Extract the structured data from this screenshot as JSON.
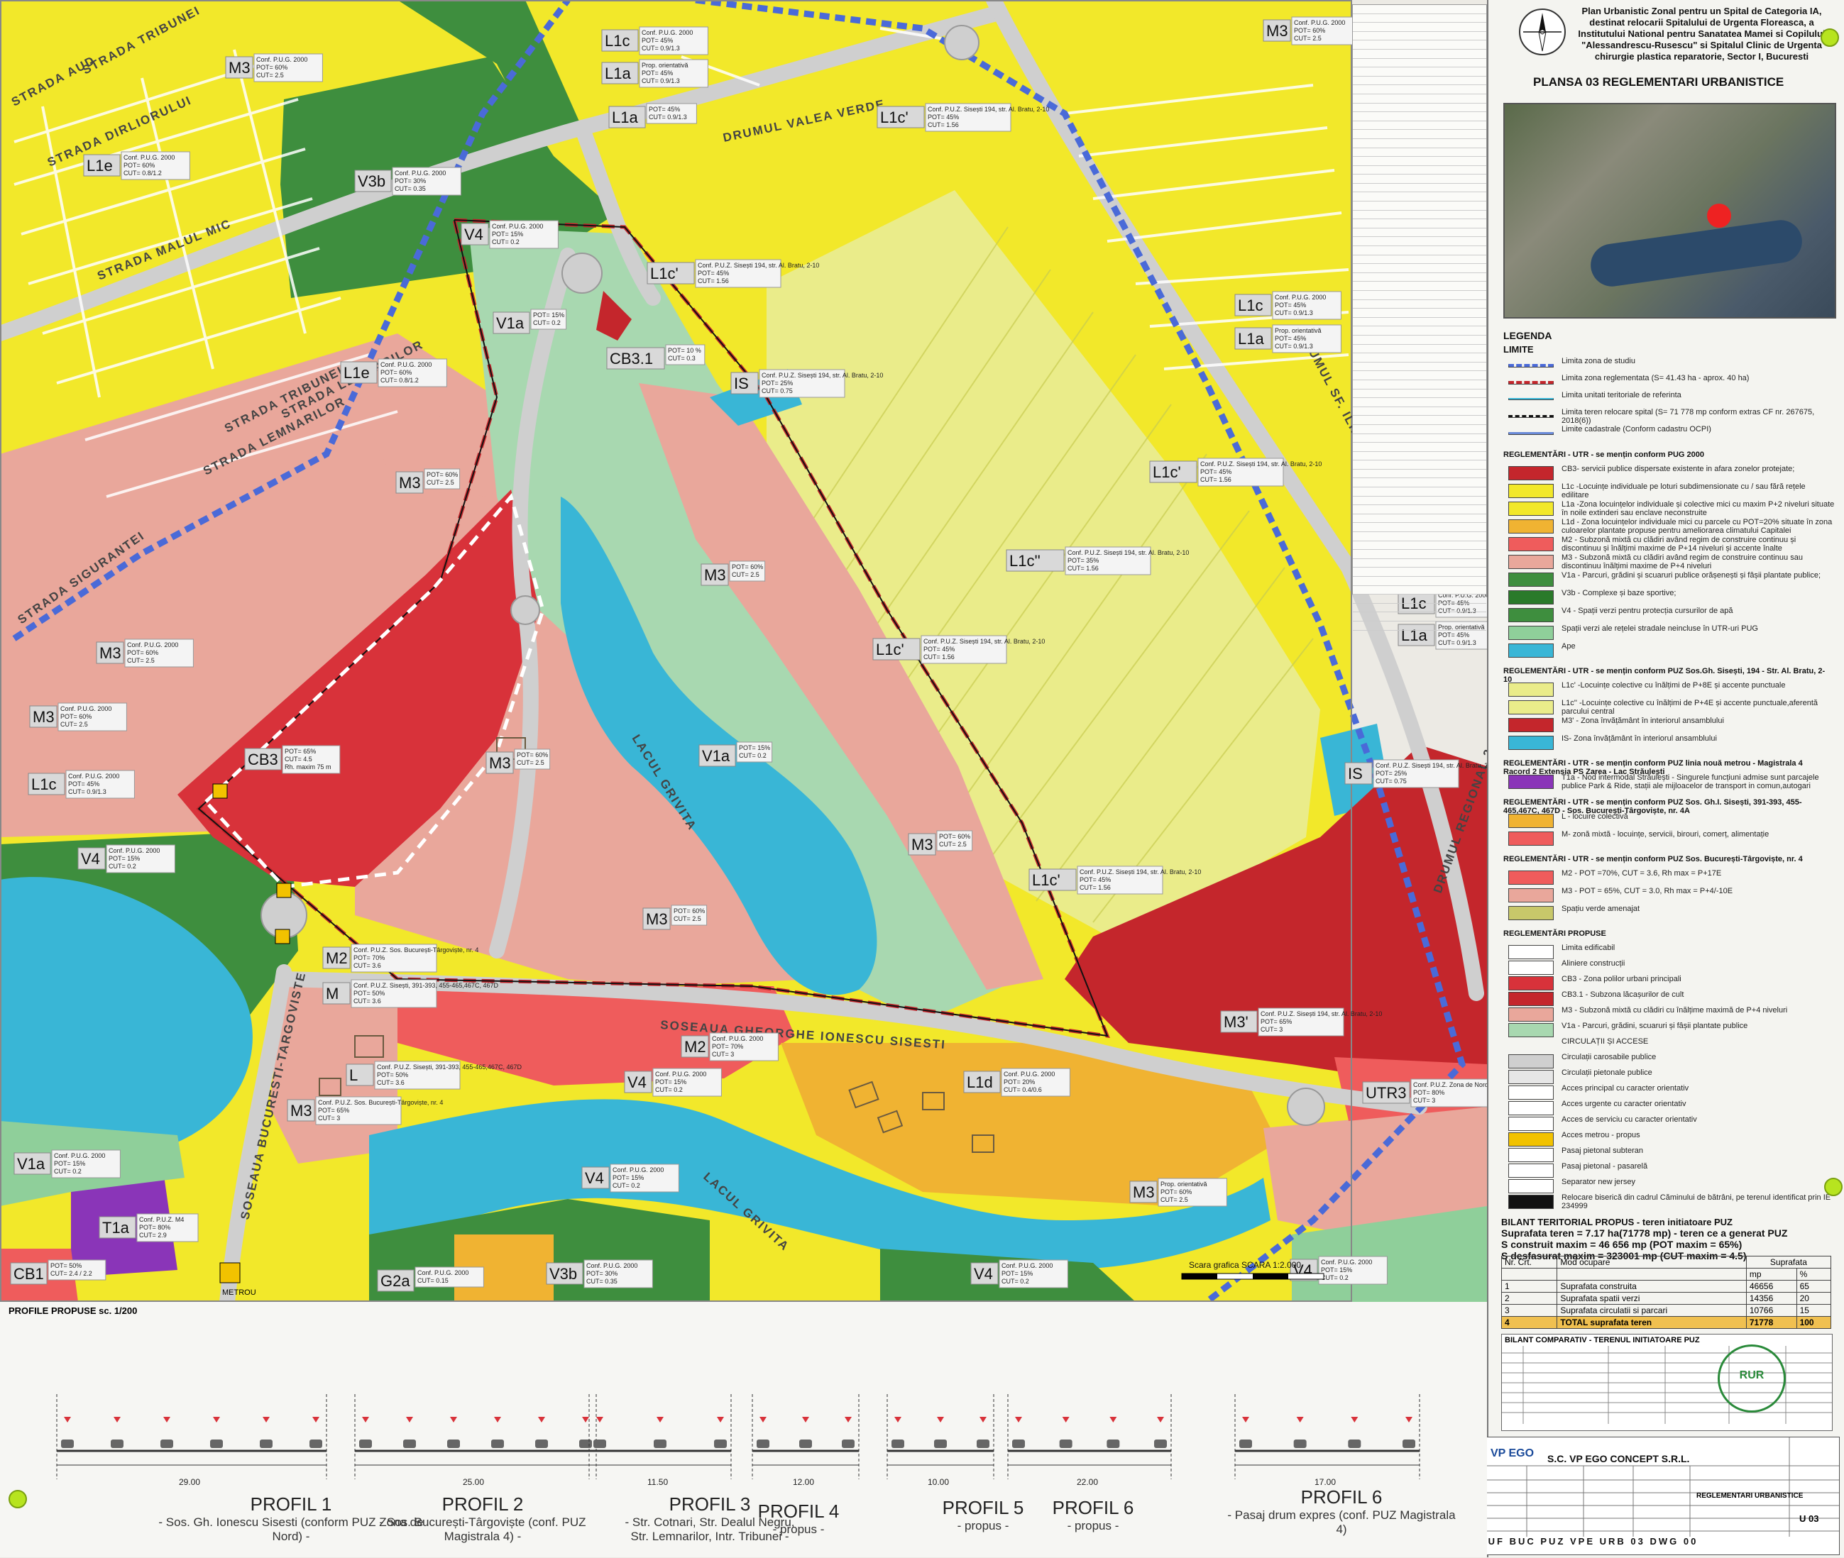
{
  "header": {
    "title": "Plan Urbanistic Zonal pentru un Spital de Categoria IA, destinat relocarii Spitalului de Urgenta Floreasca, a Institutului National pentru Sanatatea Mamei si Copilului \"Alessandrescu-Rusescu\" si Spitalul Clinic de Urgenta chirurgie plastica reparatorie, Sector I, Bucuresti",
    "plansa": "PLANSA 03 REGLEMENTARI URBANISTICE"
  },
  "colors": {
    "yellow": "#f2e82a",
    "light_yellow": "#eaec8a",
    "pink": "#e9a79b",
    "red": "#d8323a",
    "dark_red": "#c4262c",
    "salmon": "#ef5c5c",
    "green": "#3e8e3e",
    "light_green": "#8fcf9a",
    "cyan": "#39b6d6",
    "orange": "#f0b332",
    "purple": "#8a35b8",
    "mint": "#a8d8b0",
    "road": "#cfcfcf"
  },
  "streets": [
    "STRADA AUD",
    "STRADA TRIBUNEI",
    "STRADA DIRLIORULUI",
    "STRADA MALUL MIC",
    "STRADA LEMNARILOR",
    "STRADA TRIBUNEI",
    "STRADA LEMNARILOR",
    "SOSEAUA BUCURESTI-TARGOVISTE",
    "DRUMUL VALEA VERDE",
    "SOSEAUA GHEORGHE IONESCU SISESTI",
    "LACUL GRIVITA",
    "LACUL GRIVITA",
    "DRUMUL SF. ILIE",
    "DRUMUL REGIONAL 2",
    "STRADA SIGURANTEI"
  ],
  "zones": [
    {
      "code": "M3",
      "l1": "Conf. P.U.G. 2000",
      "l2": "POT= 60%",
      "l3": "CUT= 2.5"
    },
    {
      "code": "L1c",
      "l1": "Conf. P.U.G. 2000",
      "l2": "POT= 45%",
      "l3": "CUT= 0.9/1.3"
    },
    {
      "code": "L1a",
      "l1": "Prop. orientativă",
      "l2": "POT= 45%",
      "l3": "CUT= 0.9/1.3"
    },
    {
      "code": "M3",
      "l1": "Conf. P.U.G. 2000",
      "l2": "POT= 60%",
      "l3": "CUT= 2.5"
    },
    {
      "code": "L1a",
      "l1": "POT= 45%",
      "l2": "CUT= 0.9/1.3",
      "l3": ""
    },
    {
      "code": "L1e",
      "l1": "Conf. P.U.G. 2000",
      "l2": "POT= 60%",
      "l3": "CUT= 0.8/1.2"
    },
    {
      "code": "V3b",
      "l1": "Conf. P.U.G. 2000",
      "l2": "POT= 30%",
      "l3": "CUT= 0.35"
    },
    {
      "code": "V4",
      "l1": "Conf. P.U.G. 2000",
      "l2": "POT= 15%",
      "l3": "CUT= 0.2"
    },
    {
      "code": "L1c'",
      "l1": "Conf. P.U.Z. Sisești 194, str. Al. Bratu, 2-10",
      "l2": "POT= 45%",
      "l3": "CUT= 1.56"
    },
    {
      "code": "L1c'",
      "l1": "Conf. P.U.Z. Sisești 194, str. Al. Bratu, 2-10",
      "l2": "POT= 45%",
      "l3": "CUT= 1.56"
    },
    {
      "code": "V1a",
      "l1": "POT= 15%",
      "l2": "CUT= 0.2",
      "l3": ""
    },
    {
      "code": "CB3.1",
      "l1": "POT= 10 %",
      "l2": "CUT= 0.3",
      "l3": ""
    },
    {
      "code": "L1e",
      "l1": "Conf. P.U.G. 2000",
      "l2": "POT= 60%",
      "l3": "CUT= 0.8/1.2"
    },
    {
      "code": "IS",
      "l1": "Conf. P.U.Z. Sisești 194, str. Al. Bratu, 2-10",
      "l2": "POT= 25%",
      "l3": "CUT= 0.75"
    },
    {
      "code": "L1c",
      "l1": "Conf. P.U.G. 2000",
      "l2": "POT= 45%",
      "l3": "CUT= 0.9/1.3"
    },
    {
      "code": "L1a",
      "l1": "Prop. orientativă",
      "l2": "POT= 45%",
      "l3": "CUT= 0.9/1.3"
    },
    {
      "code": "M3",
      "l1": "POT= 60%",
      "l2": "CUT= 2.5",
      "l3": ""
    },
    {
      "code": "L1c'",
      "l1": "Conf. P.U.Z. Sisești 194, str. Al. Bratu, 2-10",
      "l2": "POT= 45%",
      "l3": "CUT= 1.56"
    },
    {
      "code": "L1c''",
      "l1": "Conf. P.U.Z. Sisești 194, str. Al. Bratu, 2-10",
      "l2": "POT= 35%",
      "l3": "CUT= 1.56"
    },
    {
      "code": "M3",
      "l1": "POT= 60%",
      "l2": "CUT= 2.5",
      "l3": ""
    },
    {
      "code": "M3",
      "l1": "Conf. P.U.G. 2000",
      "l2": "POT= 60%",
      "l3": "CUT= 2.5"
    },
    {
      "code": "M3",
      "l1": "Conf. P.U.G. 2000",
      "l2": "POT= 60%",
      "l3": "CUT= 2.5"
    },
    {
      "code": "L1c'",
      "l1": "Conf. P.U.Z. Sisești 194, str. Al. Bratu, 2-10",
      "l2": "POT= 45%",
      "l3": "CUT= 1.56"
    },
    {
      "code": "L1c",
      "l1": "Conf. P.U.G. 2000",
      "l2": "POT= 45%",
      "l3": "CUT= 0.9/1.3"
    },
    {
      "code": "L1a",
      "l1": "Prop. orientativă",
      "l2": "POT= 45%",
      "l3": "CUT= 0.9/1.3"
    },
    {
      "code": "L1c",
      "l1": "Conf. P.U.G. 2000",
      "l2": "POT= 45%",
      "l3": "CUT= 0.9/1.3"
    },
    {
      "code": "CB3",
      "l1": "POT= 65%",
      "l2": "CUT= 4.5",
      "l3": "Rh. maxim 75 m"
    },
    {
      "code": "M3",
      "l1": "POT= 60%",
      "l2": "CUT= 2.5",
      "l3": ""
    },
    {
      "code": "V1a",
      "l1": "POT= 15%",
      "l2": "CUT= 0.2",
      "l3": ""
    },
    {
      "code": "IS",
      "l1": "Conf. P.U.Z. Sisești 194, str. Al. Bratu, 2-10",
      "l2": "POT= 25%",
      "l3": "CUT= 0.75"
    },
    {
      "code": "V4",
      "l1": "Conf. P.U.G. 2000",
      "l2": "POT= 15%",
      "l3": "CUT= 0.2"
    },
    {
      "code": "M3",
      "l1": "POT= 60%",
      "l2": "CUT= 2.5",
      "l3": ""
    },
    {
      "code": "M3",
      "l1": "POT= 60%",
      "l2": "CUT= 2.5",
      "l3": ""
    },
    {
      "code": "L1c'",
      "l1": "Conf. P.U.Z. Sisești 194, str. Al. Bratu, 2-10",
      "l2": "POT= 45%",
      "l3": "CUT= 1.56"
    },
    {
      "code": "M2",
      "l1": "Conf. P.U.Z. Sos. București-Târgoviște, nr. 4",
      "l2": "POT= 70%",
      "l3": "CUT= 3.6"
    },
    {
      "code": "M",
      "l1": "Conf. P.U.Z. Sisești, 391-393, 455-465,467C, 467D",
      "l2": "POT= 50%",
      "l3": "CUT= 3.6"
    },
    {
      "code": "M2",
      "l1": "Conf. P.U.G. 2000",
      "l2": "POT= 70%",
      "l3": "CUT= 3"
    },
    {
      "code": "M3'",
      "l1": "Conf. P.U.Z. Sisești 194, str. Al. Bratu, 2-10",
      "l2": "POT= 65%",
      "l3": "CUT= 3"
    },
    {
      "code": "V4",
      "l1": "Conf. P.U.G. 2000",
      "l2": "POT= 15%",
      "l3": "CUT= 0.2"
    },
    {
      "code": "L",
      "l1": "Conf. P.U.Z. Sisești, 391-393, 455-465,467C, 467D",
      "l2": "POT= 50%",
      "l3": "CUT= 3.6"
    },
    {
      "code": "L1d",
      "l1": "Conf. P.U.G. 2000",
      "l2": "POT= 20%",
      "l3": "CUT= 0.4/0.6"
    },
    {
      "code": "M3",
      "l1": "Conf. P.U.Z. Sos. București-Târgoviște, nr. 4",
      "l2": "POT= 65%",
      "l3": "CUT= 3"
    },
    {
      "code": "UTR3",
      "l1": "Conf. P.U.Z. Zona de Nord",
      "l2": "POT= 80%",
      "l3": "CUT= 3"
    },
    {
      "code": "V4",
      "l1": "Conf. P.U.G. 2000",
      "l2": "POT= 15%",
      "l3": "CUT= 0.2"
    },
    {
      "code": "V1a",
      "l1": "Conf. P.U.G. 2000",
      "l2": "POT= 15%",
      "l3": "CUT= 0.2"
    },
    {
      "code": "T1a",
      "l1": "Conf. P.U.Z. M4",
      "l2": "POT= 80%",
      "l3": "CUT= 2.9"
    },
    {
      "code": "V4",
      "l1": "Conf. P.U.G. 2000",
      "l2": "POT= 15%",
      "l3": "CUT= 0.2"
    },
    {
      "code": "M3",
      "l1": "Prop. orientativă",
      "l2": "POT= 60%",
      "l3": "CUT= 2.5"
    },
    {
      "code": "CB1",
      "l1": "POT= 50%",
      "l2": "CUT= 2.4 / 2.2",
      "l3": ""
    },
    {
      "code": "G2a",
      "l1": "Conf. P.U.G. 2000",
      "l2": "CUT= 0.15",
      "l3": ""
    },
    {
      "code": "V3b",
      "l1": "Conf. P.U.G. 2000",
      "l2": "POT= 30%",
      "l3": "CUT= 0.35"
    },
    {
      "code": "V4",
      "l1": "Conf. P.U.G. 2000",
      "l2": "POT= 15%",
      "l3": "CUT= 0.2"
    },
    {
      "code": "V1a",
      "l1": "Conf. P.U.G. 2000",
      "l2": "POT= 15%",
      "l3": "CUT= 0.2"
    }
  ],
  "metro_label": "METROU",
  "scale_note": "Scara grafica SCARA 1:2.000",
  "profiles_title": "PROFILE PROPUSE  sc. 1/200",
  "profiles": [
    {
      "name": "PROFIL 1",
      "desc": "- Sos. Gh. Ionescu Sisesti (conform PUZ Zona de Nord) -"
    },
    {
      "name": "PROFIL 2",
      "desc": "- Sos. București-Târgoviște (conf. PUZ Magistrala 4) -"
    },
    {
      "name": "PROFIL 3",
      "desc": "- Str. Cotnari, Str. Dealul Negru, Str. Lemnarilor, Intr. Tribunei -"
    },
    {
      "name": "PROFIL 4",
      "desc": "- propus -"
    },
    {
      "name": "PROFIL 5",
      "desc": "- propus -"
    },
    {
      "name": "PROFIL 6",
      "desc": "- propus -"
    },
    {
      "name": "PROFIL 6",
      "desc": "- Pasaj drum expres (conf. PUZ Magistrala 4)"
    }
  ],
  "profile_widths": [
    "29.00",
    "25.00",
    "11.50",
    "12.00",
    "10.00",
    "22.00",
    "17.00"
  ],
  "legend": {
    "title": "LEGENDA",
    "limite_title": "LIMITE",
    "limite": [
      "Limita zona de studiu",
      "Limita zona reglementata (S= 41.43 ha - aprox. 40 ha)",
      "Limita unitati teritoriale de referinta",
      "Limita teren relocare spital (S= 71 778 mp conform extras CF nr. 267675, 2018(6))",
      "Limite cadastrale (Conform cadastru OCPI)"
    ],
    "s1_title": "REGLEMENTĂRI - UTR - se mențin conform PUG 2000",
    "s1": [
      "CB3- servicii publice dispersate existente in afara zonelor protejate;",
      "L1c -Locuințe individuale pe loturi subdimensionate cu / sau fără rețele edilitare",
      "L1a -Zona locuințelor individuale și colective mici cu maxim P+2 niveluri situate în noile extinderi sau enclave neconstruite",
      "L1d - Zona locuințelor individuale mici cu parcele cu POT=20% situate în zona culoarelor plantate propuse pentru ameliorarea climatului Capitalei",
      "M2 - Subzonă mixtă cu clădiri având regim de construire continuu și discontinuu și înălțimi maxime de P+14 niveluri și accente înalte",
      "M3 - Subzonă mixtă cu clădiri având regim de construire continuu sau discontinuu înălțimi maxime de P+4 niveluri",
      "V1a - Parcuri, grădini și scuaruri publice orășenești și fâșii plantate publice;",
      "V3b - Complexe și baze sportive;",
      "V4 - Spații verzi pentru protecția cursurilor de apă",
      "Spații verzi ale rețelei stradale neincluse în UTR-uri PUG",
      "Ape"
    ],
    "s2_title": "REGLEMENTĂRI - UTR - se mențin conform PUZ Sos.Gh. Sisești, 194 - Str. Al. Bratu, 2-10",
    "s2": [
      "L1c' -Locuințe colective cu înălțimi de P+8E și accente punctuale",
      "L1c'' -Locuințe colective cu înălțimi de P+4E și accente punctuale,aferentă parcului central",
      "M3' - Zona învățământ în interiorul ansamblului",
      "IS- Zona învățământ în interiorul ansamblului"
    ],
    "s3_title": "REGLEMENTĂRI - UTR - se mențin conform PUZ linia nouă metrou - Magistrala 4 Racord 2 Extensia PS Zarea - Lac Străulești",
    "s3": [
      "T1a - Nod intermodal Străulești - Singurele funcțiuni admise sunt parcajele publice Park & Ride, stații ale mijloacelor de transport in comun,autogari"
    ],
    "s4_title": "REGLEMENTĂRI - UTR - se mențin conform PUZ Sos. Gh.I. Sisești, 391-393, 455-465,467C, 467D - Sos. București-Târgoviște, nr. 4A",
    "s4": [
      "L - locuire colectivă",
      "M- zonă mixtă - locuințe, servicii, birouri, comerț, alimentație"
    ],
    "s5_title": "REGLEMENTĂRI - UTR - se mențin conform PUZ Sos. București-Târgoviște, nr. 4",
    "s5": [
      "M2 - POT =70%, CUT = 3.6, Rh max = P+17E",
      "M3 - POT = 65%, CUT = 3.0, Rh max = P+4/-10E",
      "Spațiu verde amenajat"
    ],
    "s6_title": "REGLEMENTĂRI PROPUSE",
    "s6": [
      "Limita edificabil",
      "Aliniere construcții",
      "CB3 - Zona polilor urbani principali",
      "CB3.1 - Subzona lăcașurilor de cult",
      "M3 - Subzonă mixtă cu clădiri cu înălțime maximă de P+4 niveluri",
      "V1a - Parcuri, grădini, scuaruri și fâșii plantate publice",
      "CIRCULAȚII ȘI ACCESE",
      "Circulații carosabile publice",
      "Circulații pietonale publice",
      "Acces principal cu caracter orientativ",
      "Acces urgente cu caracter orientativ",
      "Acces de serviciu cu caracter orientativ",
      "Acces metrou - propus",
      "Pasaj pietonal subteran",
      "Pasaj pietonal - pasarelă",
      "Separator new jersey",
      "Relocare biserică din cadrul Căminului de bătrâni, pe terenul identificat prin IE 234999"
    ]
  },
  "bilant": {
    "title": "BILANT TERITORIAL PROPUS - teren initiatoare PUZ",
    "lines": [
      "Suprafata teren = 7.17 ha(71778 mp) - teren ce a generat PUZ",
      "S construit maxim = 46 656 mp (POT maxim = 65%)",
      "S desfasurat maxim = 323001 mp (CUT maxim = 4.5)"
    ],
    "table_header": [
      "Nr. Crt.",
      "Mod ocupare",
      "mp",
      "%"
    ],
    "table_super": "Suprafata",
    "rows": [
      [
        "1",
        "Suprafata construita",
        "46656",
        "65"
      ],
      [
        "2",
        "Suprafata spatii verzi",
        "14356",
        "20"
      ],
      [
        "3",
        "Suprafata circulatii si parcari",
        "10766",
        "15"
      ],
      [
        "4",
        "TOTAL suprafata teren",
        "71778",
        "100"
      ]
    ],
    "comparativ_title": "BILANT COMPARATIV - TERENUL INITIATOARE PUZ"
  },
  "company": {
    "logo": "VP EGO",
    "name": "S.C. VP EGO CONCEPT S.R.L.",
    "code": "SUF BUC PUZ VPE URB 03 DWG 00",
    "plansa_nr": "U 03",
    "drawing_name": "REGLEMENTARI URBANISTICE",
    "stamp": "RUR"
  }
}
